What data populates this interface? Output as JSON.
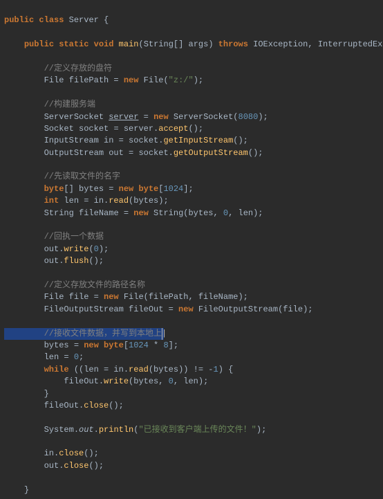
{
  "code": {
    "l1_public": "public",
    "l1_class": "class",
    "l1_name": "Server",
    "l1_brace": " {",
    "l3_public": "public",
    "l3_static": "static",
    "l3_void": "void",
    "l3_main": "main",
    "l3_paren_open": "(",
    "l3_string": "String",
    "l3_args": "[] args) ",
    "l3_throws": "throws",
    "l3_ex1": "IOException",
    "l3_ex2": "InterruptedException",
    "l3_brace": " {",
    "c1": "//定义存放的盘符",
    "l5_file": "File",
    "l5_fp": " filePath = ",
    "l5_new": "new",
    "l5_file2": " File(",
    "l5_str": "\"z:/\"",
    "l5_end": ");",
    "c2": "//构建服务端",
    "l7_ss": "ServerSocket",
    "l7_srv": "server",
    "l7_eq": " = ",
    "l7_new": "new",
    "l7_ss2": " ServerSocket(",
    "l7_num": "8080",
    "l7_end": ");",
    "l8_sock": "Socket",
    "l8_var": " socket = server.",
    "l8_accept": "accept",
    "l8_end": "();",
    "l9_is": "InputStream",
    "l9_in": " in = socket.",
    "l9_gis": "getInputStream",
    "l9_end": "();",
    "l10_os": "OutputStream",
    "l10_out": " out = socket.",
    "l10_gos": "getOutputStream",
    "l10_end": "();",
    "c3": "//先读取文件的名字",
    "l12_byte": "byte",
    "l12_arr": "[] bytes = ",
    "l12_new": "new byte",
    "l12_br": "[",
    "l12_num": "1024",
    "l12_end": "];",
    "l13_int": "int",
    "l13_len": " len = in.",
    "l13_read": "read",
    "l13_end": "(bytes);",
    "l14_str": "String",
    "l14_fn": " fileName = ",
    "l14_new": "new",
    "l14_str2": " String(bytes, ",
    "l14_z": "0",
    "l14_end": ", len);",
    "c4": "//回执一个数据",
    "l16_a": "out.",
    "l16_write": "write",
    "l16_p": "(",
    "l16_z": "0",
    "l16_end": ");",
    "l17_a": "out.",
    "l17_flush": "flush",
    "l17_end": "();",
    "c5": "//定义存放文件的路径名称",
    "l19_file": "File",
    "l19_a": " file = ",
    "l19_new": "new",
    "l19_rest": " File(filePath, fileName);",
    "l20_fos": "FileOutputStream",
    "l20_a": " fileOut = ",
    "l20_new": "new",
    "l20_fos2": " FileOutputStream",
    "l20_end": "(file);",
    "c6": "//接收文件数据，并写到本地上",
    "l22_a": "bytes = ",
    "l22_new": "new byte",
    "l22_br": "[",
    "l22_n1": "1024",
    "l22_op": " * ",
    "l22_n2": "8",
    "l22_end": "];",
    "l23_a": "len = ",
    "l23_z": "0",
    "l23_end": ";",
    "l24_while": "while",
    "l24_a": " ((len = in.",
    "l24_read": "read",
    "l24_b": "(bytes)) != -",
    "l24_one": "1",
    "l24_end": ") {",
    "l25_a": "fileOut.",
    "l25_write": "write",
    "l25_b": "(bytes, ",
    "l25_z": "0",
    "l25_end": ", len);",
    "l26": "}",
    "l27_a": "fileOut.",
    "l27_close": "close",
    "l27_end": "();",
    "l29_sys": "System.",
    "l29_out": "out",
    "l29_dot": ".",
    "l29_println": "println",
    "l29_p": "(",
    "l29_str": "\"已接收到客户端上传的文件！\"",
    "l29_end": ");",
    "l31_a": "in.",
    "l31_close": "close",
    "l31_end": "();",
    "l32_a": "out.",
    "l32_close": "close",
    "l32_end": "();",
    "l34": "}"
  }
}
